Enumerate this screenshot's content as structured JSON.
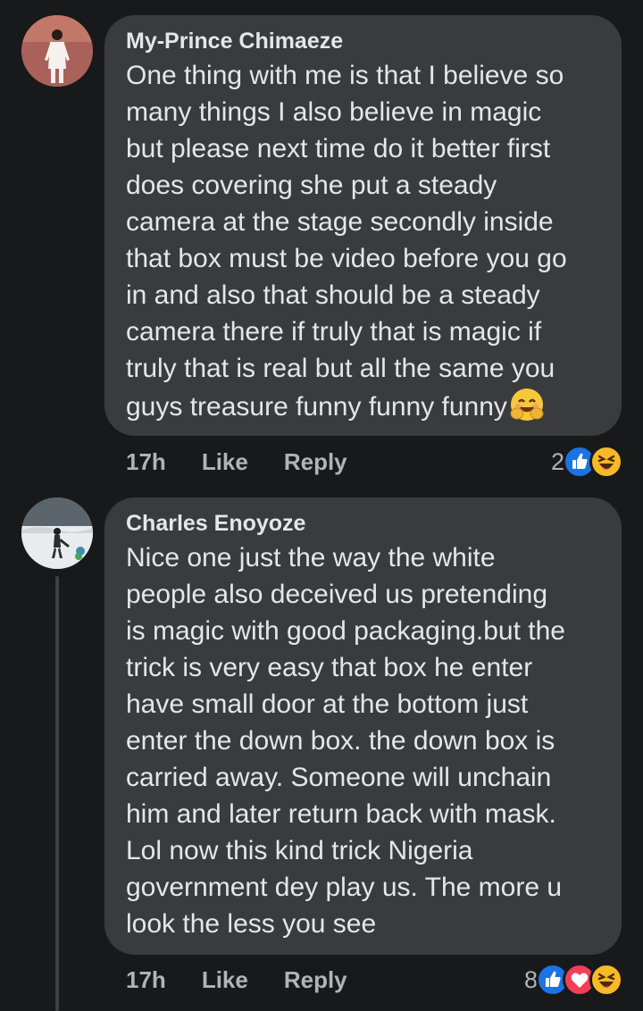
{
  "comments": [
    {
      "author": "My-Prince Chimaeze",
      "text": "One thing with me is that I believe so\nmany things I also believe in magic\nbut please next time do it better first\ndoes covering she put a steady\ncamera at the stage secondly inside\nthat box must be video before you go\nin and also that should be a steady\ncamera there if truly that is magic if\ntruly that is real but all the same you\nguys treasure funny funny funny",
      "trailing_emoji": "smiling-face-with-hands-icon",
      "time": "17h",
      "like_label": "Like",
      "reply_label": "Reply",
      "reaction_count": "2",
      "reactions": [
        "like-icon",
        "haha-icon"
      ]
    },
    {
      "author": "Charles Enoyoze",
      "text": "Nice one just the way the white\npeople also deceived us pretending\nis magic with good packaging.but the\ntrick is very easy that box he enter\nhave small door at the bottom just\nenter the down box. the down box is\ncarried away. Someone will unchain\nhim and later return back with mask.\nLol now this kind trick Nigeria\ngovernment dey play us. The more u\nlook the less you see",
      "time": "17h",
      "like_label": "Like",
      "reply_label": "Reply",
      "reaction_count": "8",
      "reactions": [
        "like-icon",
        "love-icon",
        "haha-icon"
      ]
    }
  ],
  "colors": {
    "background": "#18191a",
    "bubble": "#3a3b3c",
    "text": "#e4e6eb",
    "secondary": "#b0b3b8",
    "like_blue": "#1b74e4",
    "love_red": "#f33e58",
    "haha_yellow": "#f7b928"
  }
}
